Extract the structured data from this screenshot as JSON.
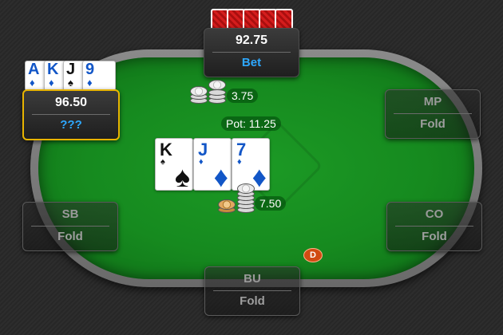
{
  "seats": {
    "top": {
      "stack": "92.75",
      "action": "Bet"
    },
    "hero": {
      "stack": "96.50",
      "action": "???"
    },
    "mp": {
      "position": "MP",
      "action": "Fold"
    },
    "sb": {
      "position": "SB",
      "action": "Fold"
    },
    "co": {
      "position": "CO",
      "action": "Fold"
    },
    "bu": {
      "position": "BU",
      "action": "Fold"
    }
  },
  "hero_cards": [
    {
      "rank": "A",
      "suit": "♦",
      "suit_name": "diamonds"
    },
    {
      "rank": "K",
      "suit": "♦",
      "suit_name": "diamonds"
    },
    {
      "rank": "J",
      "suit": "♠",
      "suit_name": "spades"
    },
    {
      "rank": "9",
      "suit": "♦",
      "suit_name": "diamonds"
    }
  ],
  "board": [
    {
      "rank": "K",
      "suit": "♠",
      "suit_name": "spades"
    },
    {
      "rank": "J",
      "suit": "♦",
      "suit_name": "diamonds"
    },
    {
      "rank": "7",
      "suit": "♦",
      "suit_name": "diamonds"
    }
  ],
  "pot": "Pot: 11.25",
  "bets": {
    "top_bet": "3.75",
    "center_bet": "7.50"
  },
  "dealer_button": "D",
  "colors": {
    "felt": "#168a1f",
    "active_border": "#e8b400",
    "bet_text": "#2ea8ff",
    "card_back": "#d51d1d"
  }
}
